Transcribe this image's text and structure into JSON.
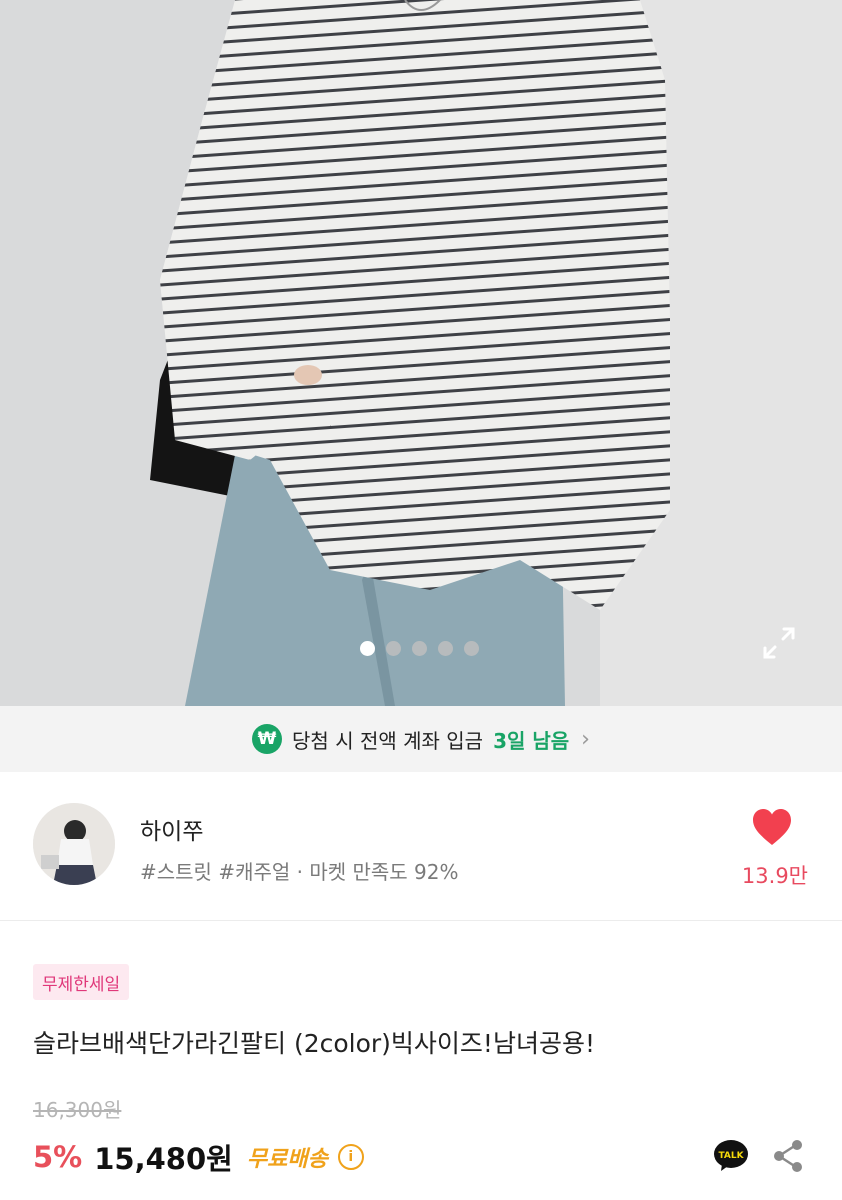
{
  "hero": {
    "image_alt": "striped long sleeve tee",
    "slide_count": 5,
    "active_slide": 1
  },
  "banner": {
    "icon": "won-icon",
    "text": "당첨 시 전액 계좌 입금",
    "highlight": "3일 남음"
  },
  "shop": {
    "name": "하이쭈",
    "tags": "#스트릿 #캐주얼 · 마켓 만족도 92%",
    "like_count": "13.9만"
  },
  "product": {
    "badge": "무제한세일",
    "title": "슬라브배색단가라긴팔티 (2color)빅사이즈!남녀공용!",
    "original_price": "16,300원",
    "discount": "5%",
    "price": "15,480원",
    "shipping": "무료배송"
  },
  "colors": {
    "accent_green": "#19a466",
    "discount_red": "#e8505b",
    "heart_red": "#f2404f",
    "badge_pink": "#e0387a",
    "shipping_orange": "#f0a21b"
  },
  "icons": [
    "won-icon",
    "chevron-right-icon",
    "heart-icon",
    "expand-icon",
    "info-icon",
    "kakao-talk-icon",
    "share-icon"
  ]
}
